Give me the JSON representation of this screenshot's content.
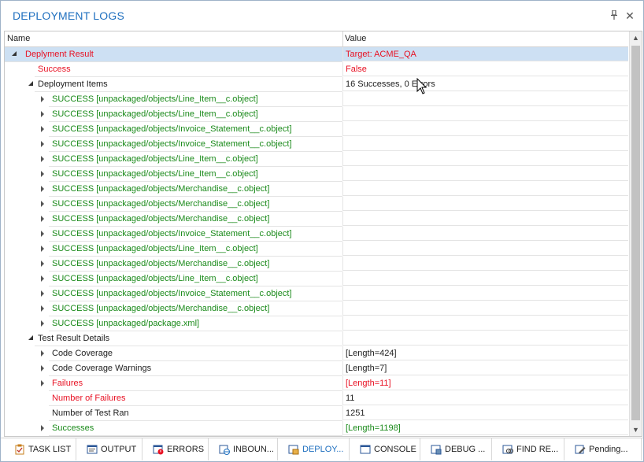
{
  "panel": {
    "title": "DEPLOYMENT LOGS",
    "pin_icon": "pin-icon",
    "close_icon": "close-icon"
  },
  "grid": {
    "columns": {
      "name": "Name",
      "value": "Value"
    },
    "rows": [
      {
        "name": "Deplyment Result",
        "value": "Target: ACME_QA",
        "color": "red",
        "indent": 0,
        "toggle": "open",
        "selected": true
      },
      {
        "name": "Success",
        "value": "False",
        "color": "red",
        "indent": 1,
        "toggle": "none"
      },
      {
        "name": "Deployment Items",
        "value": "16 Successes, 0 Errors",
        "color": "normal",
        "indent": 1,
        "toggle": "open"
      },
      {
        "name": "SUCCESS [unpackaged/objects/Line_Item__c.object]",
        "value": "",
        "color": "green",
        "indent": 2,
        "toggle": "closed"
      },
      {
        "name": "SUCCESS [unpackaged/objects/Line_Item__c.object]",
        "value": "",
        "color": "green",
        "indent": 2,
        "toggle": "closed"
      },
      {
        "name": "SUCCESS [unpackaged/objects/Invoice_Statement__c.object]",
        "value": "",
        "color": "green",
        "indent": 2,
        "toggle": "closed"
      },
      {
        "name": "SUCCESS [unpackaged/objects/Invoice_Statement__c.object]",
        "value": "",
        "color": "green",
        "indent": 2,
        "toggle": "closed"
      },
      {
        "name": "SUCCESS [unpackaged/objects/Line_Item__c.object]",
        "value": "",
        "color": "green",
        "indent": 2,
        "toggle": "closed"
      },
      {
        "name": "SUCCESS [unpackaged/objects/Line_Item__c.object]",
        "value": "",
        "color": "green",
        "indent": 2,
        "toggle": "closed"
      },
      {
        "name": "SUCCESS [unpackaged/objects/Merchandise__c.object]",
        "value": "",
        "color": "green",
        "indent": 2,
        "toggle": "closed"
      },
      {
        "name": "SUCCESS [unpackaged/objects/Merchandise__c.object]",
        "value": "",
        "color": "green",
        "indent": 2,
        "toggle": "closed"
      },
      {
        "name": "SUCCESS [unpackaged/objects/Merchandise__c.object]",
        "value": "",
        "color": "green",
        "indent": 2,
        "toggle": "closed"
      },
      {
        "name": "SUCCESS [unpackaged/objects/Invoice_Statement__c.object]",
        "value": "",
        "color": "green",
        "indent": 2,
        "toggle": "closed"
      },
      {
        "name": "SUCCESS [unpackaged/objects/Line_Item__c.object]",
        "value": "",
        "color": "green",
        "indent": 2,
        "toggle": "closed"
      },
      {
        "name": "SUCCESS [unpackaged/objects/Merchandise__c.object]",
        "value": "",
        "color": "green",
        "indent": 2,
        "toggle": "closed"
      },
      {
        "name": "SUCCESS [unpackaged/objects/Line_Item__c.object]",
        "value": "",
        "color": "green",
        "indent": 2,
        "toggle": "closed"
      },
      {
        "name": "SUCCESS [unpackaged/objects/Invoice_Statement__c.object]",
        "value": "",
        "color": "green",
        "indent": 2,
        "toggle": "closed"
      },
      {
        "name": "SUCCESS [unpackaged/objects/Merchandise__c.object]",
        "value": "",
        "color": "green",
        "indent": 2,
        "toggle": "closed"
      },
      {
        "name": "SUCCESS [unpackaged/package.xml]",
        "value": "",
        "color": "green",
        "indent": 2,
        "toggle": "closed"
      },
      {
        "name": "Test Result Details",
        "value": "",
        "color": "normal",
        "indent": 1,
        "toggle": "open"
      },
      {
        "name": "Code Coverage",
        "value": "[Length=424]",
        "color": "normal",
        "indent": 2,
        "toggle": "closed"
      },
      {
        "name": "Code Coverage Warnings",
        "value": "[Length=7]",
        "color": "normal",
        "indent": 2,
        "toggle": "closed"
      },
      {
        "name": "Failures",
        "value": "[Length=11]",
        "color": "red",
        "indent": 2,
        "toggle": "closed"
      },
      {
        "name": "Number of Failures",
        "value": "11",
        "color": "red",
        "value_color": "normal",
        "indent": 2,
        "toggle": "none"
      },
      {
        "name": "Number of Test Ran",
        "value": "1251",
        "color": "normal",
        "indent": 2,
        "toggle": "none"
      },
      {
        "name": "Successes",
        "value": "[Length=1198]",
        "color": "green",
        "indent": 2,
        "toggle": "closed"
      }
    ]
  },
  "tabs": [
    {
      "label": "TASK LIST",
      "icon": "clipboard-check-icon",
      "active": false
    },
    {
      "label": "OUTPUT",
      "icon": "output-window-icon",
      "active": false
    },
    {
      "label": "ERRORS",
      "icon": "error-window-icon",
      "active": false
    },
    {
      "label": "INBOUN...",
      "icon": "inbound-globe-icon",
      "active": false
    },
    {
      "label": "DEPLOY...",
      "icon": "deploy-package-icon",
      "active": true
    },
    {
      "label": "CONSOLE",
      "icon": "console-window-icon",
      "active": false
    },
    {
      "label": "DEBUG ...",
      "icon": "debug-window-icon",
      "active": false
    },
    {
      "label": "FIND RE...",
      "icon": "find-results-icon",
      "active": false
    },
    {
      "label": "Pending...",
      "icon": "pending-edit-icon",
      "active": false
    }
  ],
  "colors": {
    "title": "#1e6fbf",
    "red": "#e81123",
    "green": "#1a8a1a",
    "selection": "#cde0f3"
  }
}
